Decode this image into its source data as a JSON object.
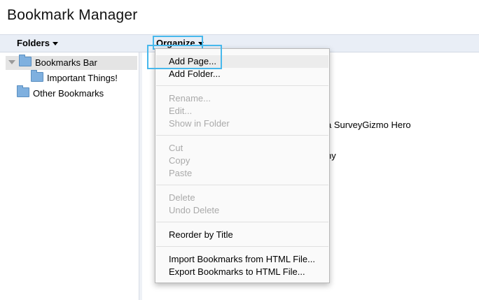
{
  "app": {
    "title": "Bookmark Manager"
  },
  "toolbar": {
    "folders_label": "Folders",
    "organize_label": "Organize"
  },
  "sidebar": {
    "items": [
      {
        "label": "Bookmarks Bar",
        "icon": "folder-icon",
        "expanded": true,
        "selected": true
      },
      {
        "label": "Important Things!",
        "icon": "folder-icon"
      },
      {
        "label": "Other Bookmarks",
        "icon": "folder-icon"
      }
    ]
  },
  "background": {
    "partial_texts": [
      "a SurveyGizmo Hero",
      "hy"
    ]
  },
  "organize_menu": {
    "items": [
      {
        "label": "Add Page...",
        "enabled": true,
        "highlighted": true
      },
      {
        "label": "Add Folder...",
        "enabled": true
      },
      {
        "label": "Rename...",
        "enabled": false
      },
      {
        "label": "Edit...",
        "enabled": false
      },
      {
        "label": "Show in Folder",
        "enabled": false
      },
      {
        "label": "Cut",
        "enabled": false
      },
      {
        "label": "Copy",
        "enabled": false
      },
      {
        "label": "Paste",
        "enabled": false
      },
      {
        "label": "Delete",
        "enabled": false
      },
      {
        "label": "Undo Delete",
        "enabled": false
      },
      {
        "label": "Reorder by Title",
        "enabled": true
      },
      {
        "label": "Import Bookmarks from HTML File...",
        "enabled": true
      },
      {
        "label": "Export Bookmarks to HTML File...",
        "enabled": true
      }
    ]
  },
  "colors": {
    "highlight_outline": "#47b8ec",
    "toolbar_bg": "#e9eef6",
    "folder_blue": "#7fb0df",
    "disabled_text": "#aaaaaa"
  }
}
